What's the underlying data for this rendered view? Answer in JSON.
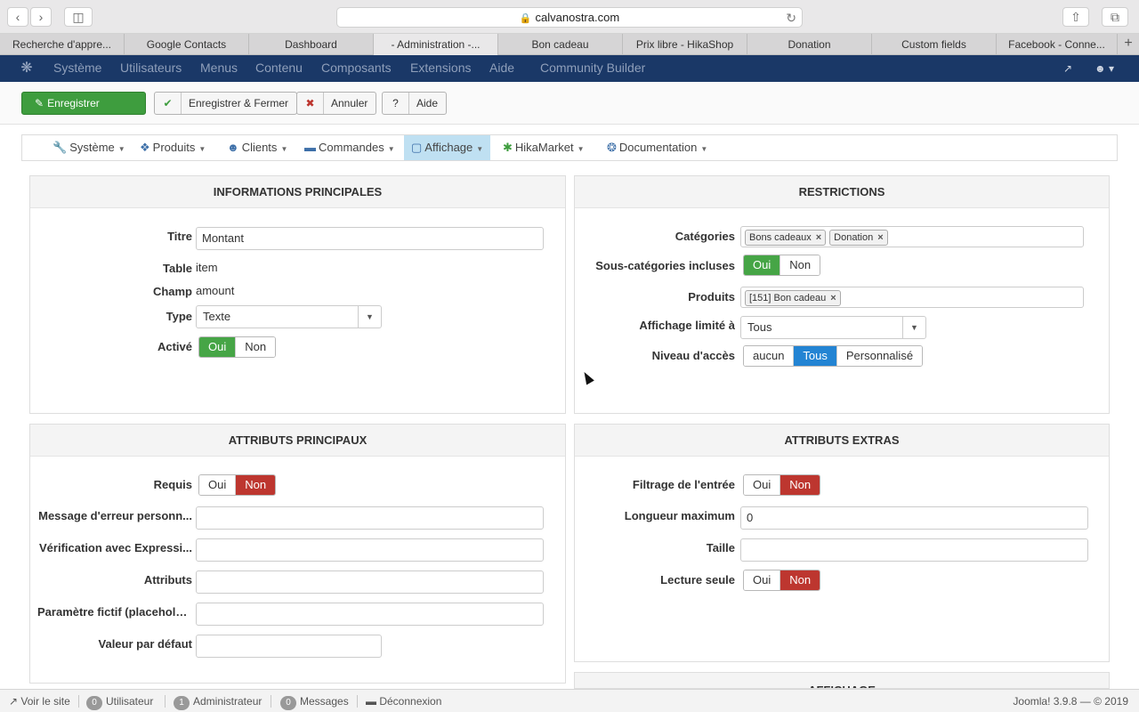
{
  "browser": {
    "url": "calvanostra.com",
    "tabs": [
      {
        "label": "Recherche d'appre..."
      },
      {
        "label": "Google Contacts"
      },
      {
        "label": "Dashboard"
      },
      {
        "label": "- Administration -..."
      },
      {
        "label": "Bon cadeau"
      },
      {
        "label": "Prix libre - HikaShop"
      },
      {
        "label": "Donation"
      },
      {
        "label": "Custom fields"
      },
      {
        "label": "Facebook - Conne..."
      }
    ]
  },
  "joomla_nav": {
    "items": [
      "Système",
      "Utilisateurs",
      "Menus",
      "Contenu",
      "Composants",
      "Extensions",
      "Aide",
      "Community Builder"
    ]
  },
  "toolbar": {
    "save": "Enregistrer",
    "save_close": "Enregistrer & Fermer",
    "cancel": "Annuler",
    "help": "Aide"
  },
  "hika_menu": {
    "items": [
      "Système",
      "Produits",
      "Clients",
      "Commandes",
      "Affichage",
      "HikaMarket",
      "Documentation"
    ]
  },
  "main_info": {
    "title": "INFORMATIONS PRINCIPALES",
    "titre_label": "Titre",
    "titre_value": "Montant",
    "table_label": "Table",
    "table_value": "item",
    "champ_label": "Champ",
    "champ_value": "amount",
    "type_label": "Type",
    "type_value": "Texte",
    "active_label": "Activé",
    "yes": "Oui",
    "no": "Non"
  },
  "restrictions": {
    "title": "RESTRICTIONS",
    "categories_label": "Catégories",
    "categories": [
      "Bons cadeaux",
      "Donation"
    ],
    "subcat_label": "Sous-catégories incluses",
    "yes": "Oui",
    "no": "Non",
    "products_label": "Produits",
    "products": [
      "[151] Bon cadeau"
    ],
    "display_label": "Affichage limité à",
    "display_value": "Tous",
    "access_label": "Niveau d'accès",
    "access_none": "aucun",
    "access_all": "Tous",
    "access_custom": "Personnalisé"
  },
  "main_attrs": {
    "title": "ATTRIBUTS PRINCIPAUX",
    "required_label": "Requis",
    "yes": "Oui",
    "no": "Non",
    "error_label": "Message d'erreur personn...",
    "regex_label": "Vérification avec Expressi...",
    "attrs_label": "Attributs",
    "placeholder_label": "Paramètre fictif (placehold...",
    "default_label": "Valeur par défaut"
  },
  "extra_attrs": {
    "title": "ATTRIBUTS EXTRAS",
    "filter_label": "Filtrage de l'entrée",
    "yes": "Oui",
    "no": "Non",
    "maxlen_label": "Longueur maximum",
    "maxlen_value": "0",
    "size_label": "Taille",
    "readonly_label": "Lecture seule"
  },
  "display_panel": {
    "title": "AFFICHAGE"
  },
  "status": {
    "view_site": "Voir le site",
    "users_count": "0",
    "users_label": "Utilisateur",
    "admins_count": "1",
    "admins_label": "Administrateur",
    "messages_count": "0",
    "messages_label": "Messages",
    "logout": "Déconnexion",
    "version": "Joomla! 3.9.8  —  © 2019"
  }
}
